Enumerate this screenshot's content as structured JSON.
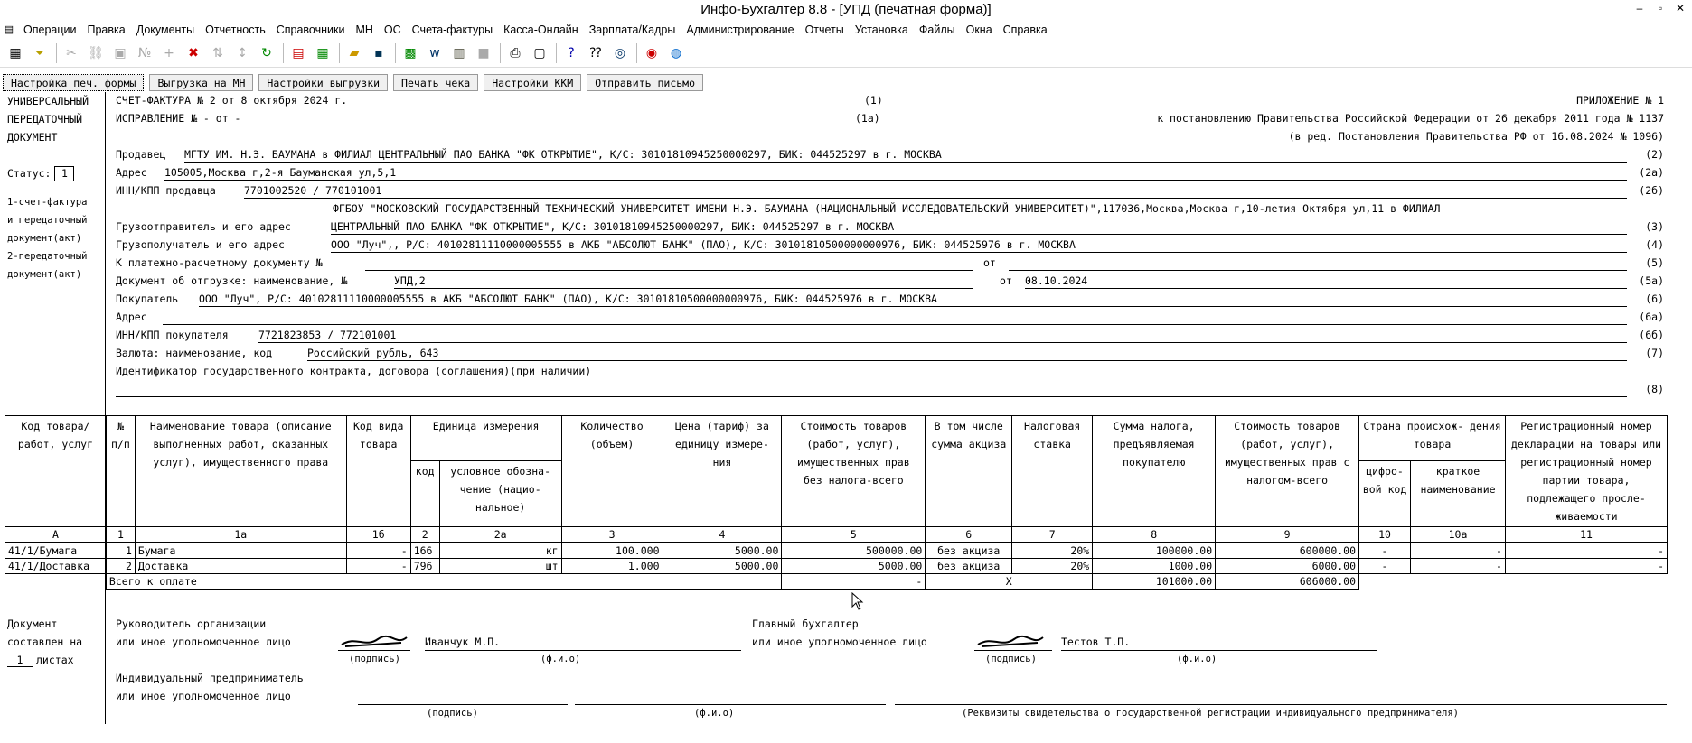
{
  "window": {
    "title": "Инфо-Бухгалтер 8.8 - [УПД (печатная форма)]"
  },
  "menu": [
    "Операции",
    "Правка",
    "Документы",
    "Отчетность",
    "Справочники",
    "МН",
    "ОС",
    "Счета-фактуры",
    "Касса-Онлайн",
    "Зарплата/Кадры",
    "Администрирование",
    "Отчеты",
    "Установка",
    "Файлы",
    "Окна",
    "Справка"
  ],
  "buttons": {
    "print_settings": "Настройка печ. формы",
    "export_mn": "Выгрузка на МН",
    "export_settings": "Настройки выгрузки",
    "print_check": "Печать чека",
    "kkm_settings": "Настройки ККМ",
    "send_letter": "Отправить письмо"
  },
  "left": {
    "l1": "УНИВЕРСАЛЬНЫЙ",
    "l2": "ПЕРЕДАТОЧНЫЙ",
    "l3": "ДОКУМЕНТ",
    "status_label": "Статус:",
    "status_value": "1",
    "n1": "1-счет-фактура",
    "n2": "и передаточный",
    "n3": "документ(акт)",
    "n4": "2-передаточный",
    "n5": "документ(акт)",
    "doc1": "Документ",
    "doc2": "составлен на",
    "doc_sheets": "1",
    "doc3": "листах"
  },
  "header": {
    "invoice": "СЧЕТ-ФАКТУРА №   2   от   8 октября 2024 г.",
    "code1": "(1)",
    "correction": "ИСПРАВЛЕНИЕ №   -    от   -",
    "code1a": "(1а)",
    "app1": "ПРИЛОЖЕНИЕ № 1",
    "app2": "к постановлению Правительства Российской Федерации от 26 декабря 2011 года № 1137",
    "app3": "(в ред. Постановления Правительства РФ от 16.08.2024 № 1096)",
    "seller_label": "Продавец",
    "seller": "МГТУ ИМ. Н.Э. БАУМАНА в ФИЛИАЛ ЦЕНТРАЛЬНЫЙ ПАО БАНКА \"ФК ОТКРЫТИЕ\", К/С: 30101810945250000297, БИК: 044525297 в г. МОСКВА",
    "code2": "(2)",
    "addr_label": "Адрес",
    "addr": "105005,Москва г,2-я Бауманская ул,5,1",
    "code2a": "(2а)",
    "inn_label": "ИНН/КПП продавца",
    "inn": "7701002520 / 770101001",
    "code2b": "(2б)",
    "shipper_top": "ФГБОУ \"МОСКОВСКИЙ ГОСУДАРСТВЕННЫЙ ТЕХНИЧЕСКИЙ УНИВЕРСИТЕТ ИМЕНИ Н.Э. БАУМАНА (НАЦИОНАЛЬНЫЙ ИССЛЕДОВАТЕЛЬСКИЙ УНИВЕРСИТЕТ)\",117036,Москва,Москва г,10-летия Октября ул,11 в ФИЛИАЛ",
    "shipper_label": "Грузоотправитель и его адрес",
    "shipper": "ЦЕНТРАЛЬНЫЙ ПАО БАНКА \"ФК ОТКРЫТИЕ\", К/С: 30101810945250000297, БИК: 044525297 в г. МОСКВА",
    "code3": "(3)",
    "consignee_label": "Грузополучатель  и его адрес",
    "consignee": "ООО \"Луч\",, Р/С: 40102811110000005555 в АКБ \"АБСОЛЮТ БАНК\" (ПАО), К/С: 30101810500000000976, БИК: 044525976 в г. МОСКВА",
    "code4": "(4)",
    "payment_label": "К платежно-расчетному документу №",
    "payment_from": "от",
    "code5": "(5)",
    "shipdoc_label": "Документ об отгрузке: наименование, №",
    "shipdoc": "УПД,2",
    "shipdoc_from": "от",
    "shipdoc_date": "08.10.2024",
    "code5a": "(5а)",
    "buyer_label": "Покупатель",
    "buyer": "ООО \"Луч\", Р/С: 40102811110000005555 в АКБ \"АБСОЛЮТ БАНК\" (ПАО), К/С: 30101810500000000976, БИК: 044525976 в г. МОСКВА",
    "code6": "(6)",
    "baddr_label": "Адрес",
    "code6a": "(6а)",
    "binn_label": "ИНН/КПП покупателя",
    "binn": "7721823853 / 772101001",
    "code6b": "(6б)",
    "currency_label": "Валюта: наименование, код",
    "currency": "Российский рубль, 643",
    "code7": "(7)",
    "contract_label": "Идентификатор государственного контракта, договора (соглашения)(при наличии)",
    "code8": "(8)"
  },
  "table": {
    "h": {
      "c_code": "Код товара/ работ, услуг",
      "c_n": "№ п/п",
      "c_name": "Наименование товара (описание выполненных работ, оказанных услуг), имущественного права",
      "c_kind": "Код вида товара",
      "c_unit": "Единица измерения",
      "c_unit_code": "код",
      "c_unit_name": "условное обозна- чение (нацио- нальное)",
      "c_qty": "Количество (объем)",
      "c_price": "Цена (тариф) за единицу измере- ния",
      "c_cost": "Стоимость товаров (работ, услуг), имущественных прав без налога-всего",
      "c_excise": "В том числе сумма акциза",
      "c_rate": "Налоговая ставка",
      "c_tax": "Сумма налога, предъявляемая покупателю",
      "c_total": "Стоимость товаров (работ, услуг), имущественных прав с налогом-всего",
      "c_country": "Страна происхож- дения товара",
      "c_country_code": "цифро- вой код",
      "c_country_name": "краткое наименование",
      "c_reg": "Регистрационный номер декларации на товары или регистрационный номер партии товара, подлежащего просле- живаемости"
    },
    "nums": [
      "А",
      "1",
      "1а",
      "1б",
      "2",
      "2а",
      "3",
      "4",
      "5",
      "6",
      "7",
      "8",
      "9",
      "10",
      "10а",
      "11"
    ],
    "rows": [
      [
        "41/1/Бумага",
        "1",
        "Бумага",
        "-",
        "166",
        "кг",
        "100.000",
        "5000.00",
        "500000.00",
        "без акциза",
        "20%",
        "100000.00",
        "600000.00",
        "-",
        "-",
        "-"
      ],
      [
        "41/1/Доставка",
        "2",
        "Доставка",
        "-",
        "796",
        "шт",
        "1.000",
        "5000.00",
        "5000.00",
        "без акциза",
        "20%",
        "1000.00",
        "6000.00",
        "-",
        "-",
        "-"
      ]
    ],
    "total_label": "Всего к оплате",
    "total_cost": "-",
    "total_excise": "X",
    "total_tax": "101000.00",
    "total_sum": "606000.00"
  },
  "sign": {
    "head1": "Руководитель организации",
    "head2": "или иное уполномоченное лицо",
    "head_name": "Иванчук М.П.",
    "sig_cap": "(подпись)",
    "fio_cap": "(ф.и.о)",
    "acc1": "Главный бухгалтер",
    "acc2": "или иное уполномоченное лицо",
    "acc_name": "Тестов Т.П.",
    "ip1": "Индивидуальный предприниматель",
    "ip2": "или иное уполномоченное лицо",
    "ip_req": "(Реквизиты свидетельства о государственной регистрации индивидуального предпринимателя)"
  }
}
